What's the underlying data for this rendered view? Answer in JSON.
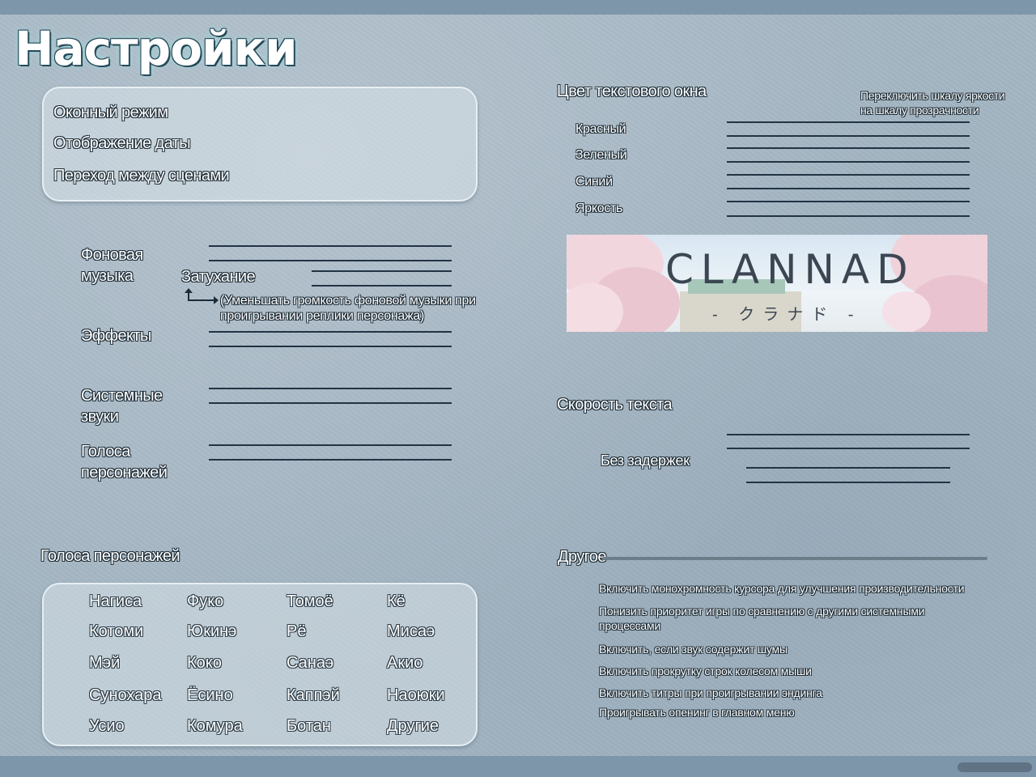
{
  "title": "Настройки",
  "display": {
    "items": [
      "Оконный режим",
      "Отображение даты",
      "Переход между сценами"
    ]
  },
  "volume": {
    "bgm_label": [
      "Фоновая",
      "музыка"
    ],
    "fade_label": "Затухание",
    "fade_note": [
      "(Уменьшать громкость фоновой музыки при",
      "проигрывании реплики персонажа)"
    ],
    "effects_label": "Эффекты",
    "system_label": [
      "Системные",
      "звуки"
    ],
    "voices_label": [
      "Голоса",
      "персонажей"
    ]
  },
  "voices": {
    "heading": "Голоса персонажей",
    "names": [
      [
        "Нагиса",
        "Фуко",
        "Томоё",
        "Кё"
      ],
      [
        "Котоми",
        "Юкинэ",
        "Рё",
        "Мисаэ"
      ],
      [
        "Мэй",
        "Коко",
        "Санаэ",
        "Акио"
      ],
      [
        "Сунохара",
        "Ёсино",
        "Каппэй",
        "Наоюки"
      ],
      [
        "Усио",
        "Комура",
        "Ботан",
        "Другие"
      ]
    ]
  },
  "text_color": {
    "heading": "Цвет текстового окна",
    "toggle": [
      "Переключить шкалу яркости",
      "на шкалу прозрачности"
    ],
    "channels": [
      "Красный",
      "Зеленый",
      "Синий",
      "Яркость"
    ]
  },
  "banner": {
    "logo": "CLANNAD",
    "subtitle": "- クラナド -"
  },
  "text_speed": {
    "heading": "Скорость текста",
    "no_delay": "Без задержек"
  },
  "other": {
    "heading": "Другое",
    "options": [
      "Включить монохромность курсора для улучшения производительности",
      "Понизить приоритет игры по сравнению с другими системными процессами",
      "Включить, если звук содержит шумы",
      "Включить прокрутку строк колесом мыши",
      "Включить титры при проигрывании эндинга",
      "Проигрывать опенинг в главном меню"
    ]
  },
  "colors": {
    "background": "#a4b6c3",
    "band": "#7e96a9",
    "slider_line": "#223344"
  }
}
